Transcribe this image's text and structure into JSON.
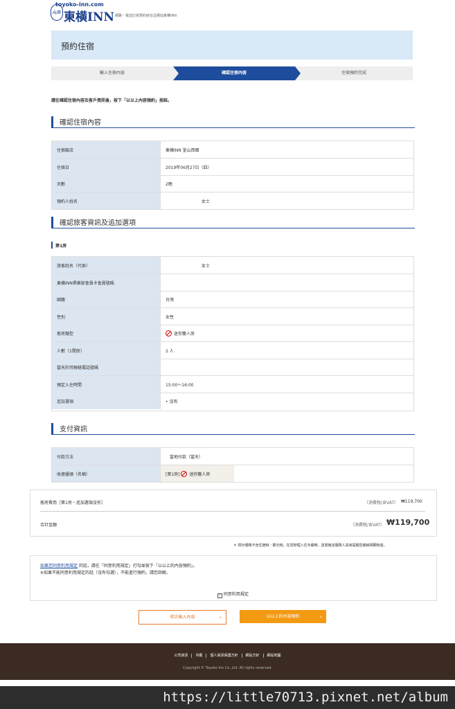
{
  "header": {
    "url": "toyoko-inn.com",
    "brand": "東横INN",
    "tagline": "網路・電話訂房預約就在這網站東横INN",
    "mark": "A/B"
  },
  "page_title": "預約住宿",
  "steps": [
    "輸入住宿內容",
    "確認住宿內容",
    "住宿預約完成"
  ],
  "instruction": "請在確認住宿內容及客戶資訊後，按下「以以上內容預約」按鈕。",
  "stay_section": {
    "heading": "確認住宿內容",
    "rows": [
      {
        "label": "住宿飯店",
        "value": "東横INN 釜山西面"
      },
      {
        "label": "住宿日",
        "value": "2019年06月27日（四）"
      },
      {
        "label": "天數",
        "value": "2晚"
      },
      {
        "label": "預約人姓名",
        "value": "女士"
      }
    ]
  },
  "guest_section": {
    "heading": "確認旅客資訊及追加選項",
    "room_label": "第1房",
    "rows": [
      {
        "label": "旅客姓名（代表）",
        "value": "女士"
      },
      {
        "label": "東横INN俱樂部會員卡會員號碼",
        "value": ""
      },
      {
        "label": "國籍",
        "value": "台灣"
      },
      {
        "label": "性別",
        "value": "女性"
      },
      {
        "label": "客房類型",
        "value": "迷你雙人房"
      },
      {
        "label": "人數（1間房）",
        "value": "2 人"
      },
      {
        "label": "當天的可聯絡電話號碼",
        "value": ""
      },
      {
        "label": "預定入住時間",
        "value": "15:00～16:00"
      },
      {
        "label": "追加選項",
        "value": "沒有"
      }
    ]
  },
  "payment_section": {
    "heading": "支付資訊",
    "rows": [
      {
        "label": "付款方法",
        "value": "當地付款（當天）"
      },
      {
        "label": "收據擡頭（名稱）",
        "value_prefix": "[第1房]",
        "value": "迷你雙人房"
      }
    ]
  },
  "cost": {
    "room_label": "客房費用［第1房・追加選項沒有］",
    "room_tax": "（消費稅/含VAT）",
    "room_amount": "₩119,700",
    "total_label": "合計金額",
    "total_tax": "（消費稅/含VAT）",
    "total_amount": "₩119,700"
  },
  "tax_note": "＊ 標示價格不含住宿稅・觀光稅，在您辦理入住手續時，該當飯店服務人員會提醒您繳納相關稅金。",
  "terms": {
    "link": "如果您同意利用規定",
    "text": " 的話，請在「同意利用規定」打勾並按下「以以上的內容預約」。",
    "line2": "※如果不能同意利用規定的話（沒有勾選），不能進行預約，請您諒解。",
    "checkbox_label": "同意利用規定"
  },
  "buttons": {
    "back": "修正輸入內容",
    "confirm": "以以上的內容預約"
  },
  "footer": {
    "links": [
      "公司資訊",
      "內觀",
      "個人資訊保護方針",
      "網站方針",
      "網站地圖"
    ],
    "copyright": "Copyright © Toyoko Inn Co.,Ltd. All rights reserved."
  },
  "watermark": "https://little70713.pixnet.net/album"
}
